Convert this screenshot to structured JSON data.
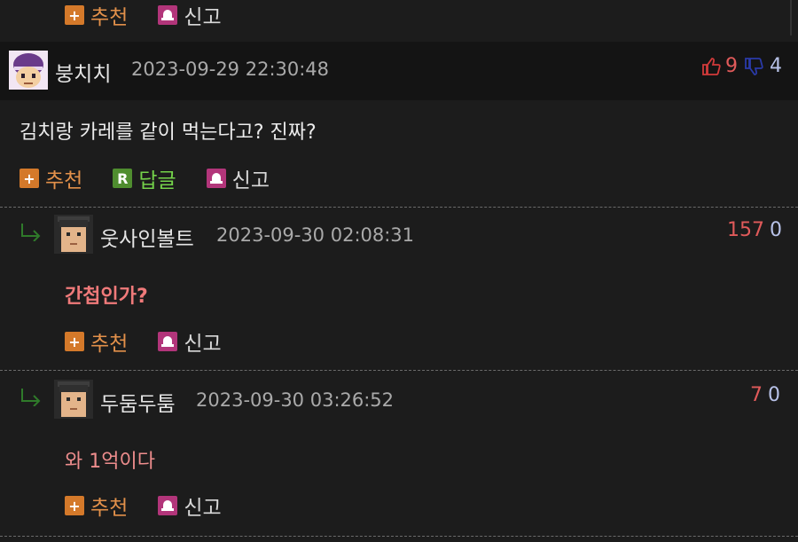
{
  "actions": {
    "recommend": "추천",
    "reply": "답글",
    "report": "신고",
    "reply_icon_letter": "R"
  },
  "comments": [
    {
      "author": "붕치치",
      "date": "2023-09-29 22:30:48",
      "text": "김치랑 카레를 같이 먹는다고? 진짜?",
      "up": "9",
      "down": "4"
    },
    {
      "author": "웃사인볼트",
      "date": "2023-09-30 02:08:31",
      "text": "간첩인가?",
      "up": "157",
      "down": "0"
    },
    {
      "author": "두둠두툼",
      "date": "2023-09-30 03:26:52",
      "text": "와 1억이다",
      "up": "7",
      "down": "0"
    }
  ],
  "colors": {
    "background": "#1c1c1c",
    "header_band": "#141414",
    "recommend": "#e2904a",
    "reply": "#74d24a",
    "report_icon": "#b2357a",
    "upvote": "#e05a5a",
    "downvote": "#b8c2e8",
    "bold_reply_text": "#f07a7a",
    "reply_text": "#ee8d8d"
  },
  "icons": {
    "recommend": "plus-icon",
    "reply": "reply-r-icon",
    "report": "siren-icon",
    "thumb_up": "thumbs-up-icon",
    "thumb_down": "thumbs-down-icon",
    "reply_arrow": "reply-arrow-icon"
  }
}
